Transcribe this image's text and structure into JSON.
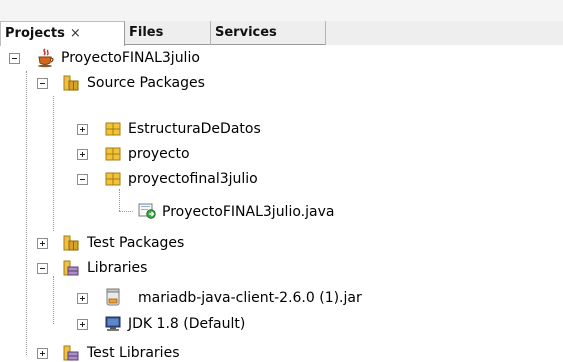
{
  "tabs": [
    {
      "label": "Projects",
      "close": "×",
      "active": true
    },
    {
      "label": "Files"
    },
    {
      "label": "Services"
    }
  ],
  "tree": {
    "project": "ProyectoFINAL3julio",
    "source_packages": "Source Packages",
    "packages": [
      "EstructuraDeDatos",
      "proyecto",
      "proyectofinal3julio"
    ],
    "java_file": "ProyectoFINAL3julio.java",
    "test_packages": "Test Packages",
    "libraries": "Libraries",
    "library_items": [
      "mariadb-java-client-2.6.0 (1).jar",
      "JDK 1.8 (Default)"
    ],
    "test_libraries": "Test Libraries"
  }
}
